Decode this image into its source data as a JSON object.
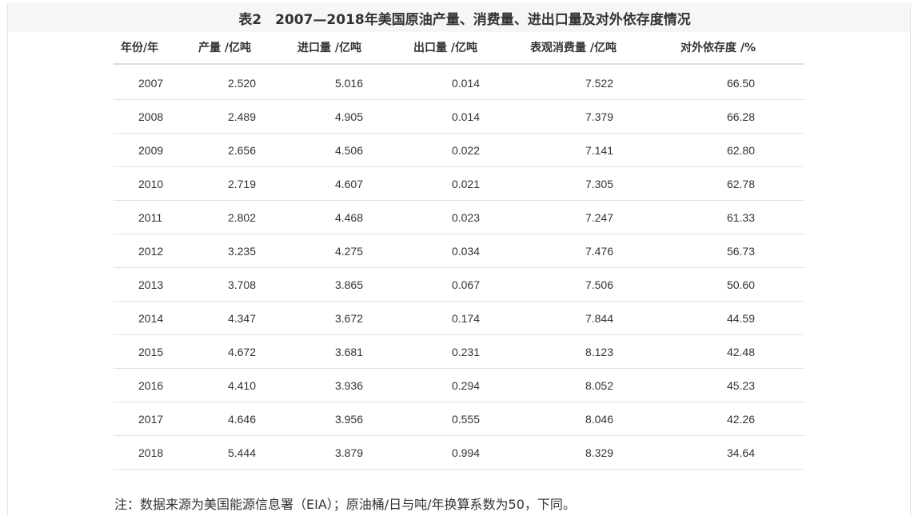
{
  "table": {
    "title": "表2　2007—2018年美国原油产量、消费量、进出口量及对外依存度情况",
    "headers": [
      "年份/年",
      "产量 /亿吨",
      "进口量 /亿吨",
      "出口量 /亿吨",
      "表观消费量 /亿吨",
      "对外依存度 /%"
    ],
    "rows": [
      [
        "2007",
        "2.520",
        "5.016",
        "0.014",
        "7.522",
        "66.50"
      ],
      [
        "2008",
        "2.489",
        "4.905",
        "0.014",
        "7.379",
        "66.28"
      ],
      [
        "2009",
        "2.656",
        "4.506",
        "0.022",
        "7.141",
        "62.80"
      ],
      [
        "2010",
        "2.719",
        "4.607",
        "0.021",
        "7.305",
        "62.78"
      ],
      [
        "2011",
        "2.802",
        "4.468",
        "0.023",
        "7.247",
        "61.33"
      ],
      [
        "2012",
        "3.235",
        "4.275",
        "0.034",
        "7.476",
        "56.73"
      ],
      [
        "2013",
        "3.708",
        "3.865",
        "0.067",
        "7.506",
        "50.60"
      ],
      [
        "2014",
        "4.347",
        "3.672",
        "0.174",
        "7.844",
        "44.59"
      ],
      [
        "2015",
        "4.672",
        "3.681",
        "0.231",
        "8.123",
        "42.48"
      ],
      [
        "2016",
        "4.410",
        "3.936",
        "0.294",
        "8.052",
        "45.23"
      ],
      [
        "2017",
        "4.646",
        "3.956",
        "0.555",
        "8.046",
        "42.26"
      ],
      [
        "2018",
        "5.444",
        "3.879",
        "0.994",
        "8.329",
        "34.64"
      ]
    ],
    "footnote": "注：数据来源为美国能源信息署（EIA）；原油桶/日与吨/年换算系数为50，下同。"
  }
}
